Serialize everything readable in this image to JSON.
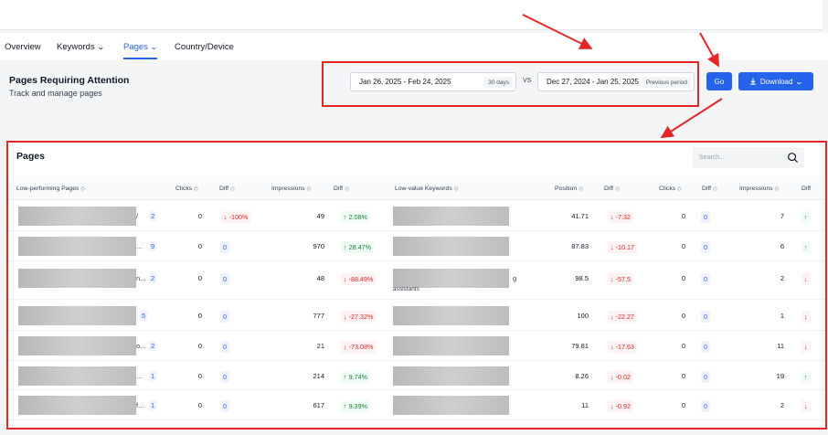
{
  "tabs": [
    {
      "label": "Overview",
      "dropdown": false,
      "active": false
    },
    {
      "label": "Keywords",
      "dropdown": true,
      "active": false
    },
    {
      "label": "Pages",
      "dropdown": true,
      "active": true
    },
    {
      "label": "Country/Device",
      "dropdown": false,
      "active": false
    }
  ],
  "header": {
    "title": "Pages Requiring Attention",
    "subtitle": "Track and manage pages",
    "current_range": "Jan 26, 2025 - Feb 24, 2025",
    "current_tag": "30 days",
    "vs": "VS",
    "previous_range": "Dec 27, 2024 - Jan 25, 2025",
    "previous_tag": "Previous period",
    "go_label": "Go",
    "download_label": "Download"
  },
  "panel": {
    "title": "Pages",
    "search_placeholder": "Search...",
    "columns": [
      "Low-performing Pages",
      "Clicks",
      "Diff",
      "Impressions",
      "Diff",
      "Low-value Keywords",
      "Position",
      "Diff",
      "Clicks",
      "Diff",
      "Impressions",
      "Diff"
    ],
    "rows": [
      {
        "trail": "/",
        "count": "2",
        "clicks": "0",
        "clicks_diff": "0",
        "clicks_diff_display": "↓ -100%",
        "clicks_diff_dir": "neg",
        "impressions": "49",
        "impr_diff": "↑ 2.08%",
        "impr_dir": "pos",
        "kw_extra": "",
        "position": "41.71",
        "pos_diff": "↓ -7.32",
        "kw_clicks": "0",
        "kw_clicks_diff": "0",
        "kw_impressions": "7",
        "kw_impr_dir": "pos"
      },
      {
        "trail": "...",
        "count": "9",
        "clicks": "0",
        "clicks_diff_display": "0",
        "clicks_diff_dir": "zero",
        "impressions": "970",
        "impr_diff": "↑ 28.47%",
        "impr_dir": "pos",
        "kw_extra": "",
        "position": "87.83",
        "pos_diff": "↓ -10.17",
        "kw_clicks": "0",
        "kw_clicks_diff": "0",
        "kw_impressions": "6",
        "kw_impr_dir": "pos"
      },
      {
        "trail": "n...",
        "count": "2",
        "clicks": "0",
        "clicks_diff_display": "0",
        "clicks_diff_dir": "zero",
        "impressions": "48",
        "impr_diff": "↓ -88.49%",
        "impr_dir": "neg",
        "kw_extra": "g",
        "kw_extra2": "assistants",
        "position": "98.5",
        "pos_diff": "↓ -57.5",
        "kw_clicks": "0",
        "kw_clicks_diff": "0",
        "kw_impressions": "2",
        "kw_impr_dir": "neg"
      },
      {
        "trail": "",
        "count": "5",
        "clicks": "0",
        "clicks_diff_display": "0",
        "clicks_diff_dir": "zero",
        "impressions": "777",
        "impr_diff": "↓ -27.32%",
        "impr_dir": "neg",
        "kw_extra": "",
        "position": "100",
        "pos_diff": "↓ -22.27",
        "kw_clicks": "0",
        "kw_clicks_diff": "0",
        "kw_impressions": "1",
        "kw_impr_dir": "neg"
      },
      {
        "trail": "o...",
        "count": "2",
        "clicks": "0",
        "clicks_diff_display": "0",
        "clicks_diff_dir": "zero",
        "impressions": "21",
        "impr_diff": "↓ -73.08%",
        "impr_dir": "neg",
        "kw_extra": "",
        "position": "79.81",
        "pos_diff": "↓ -17.63",
        "kw_clicks": "0",
        "kw_clicks_diff": "0",
        "kw_impressions": "11",
        "kw_impr_dir": "neg"
      },
      {
        "trail": "...",
        "count": "1",
        "clicks": "0",
        "clicks_diff_display": "0",
        "clicks_diff_dir": "zero",
        "impressions": "214",
        "impr_diff": "↑ 9.74%",
        "impr_dir": "pos",
        "kw_extra": "",
        "position": "8.26",
        "pos_diff": "↓ -0.02",
        "kw_clicks": "0",
        "kw_clicks_diff": "0",
        "kw_impressions": "19",
        "kw_impr_dir": "pos"
      },
      {
        "trail": "f...",
        "count": "1",
        "clicks": "0",
        "clicks_diff_display": "0",
        "clicks_diff_dir": "zero",
        "impressions": "617",
        "impr_diff": "↑ 9.39%",
        "impr_dir": "pos",
        "kw_extra": "",
        "position": "11",
        "pos_diff": "↓ -0.92",
        "kw_clicks": "0",
        "kw_clicks_diff": "0",
        "kw_impressions": "2",
        "kw_impr_dir": "neg"
      }
    ]
  },
  "colors": {
    "accent": "#2563eb",
    "annotation": "#e32626",
    "negative": "#dc2626",
    "positive": "#15803d"
  }
}
